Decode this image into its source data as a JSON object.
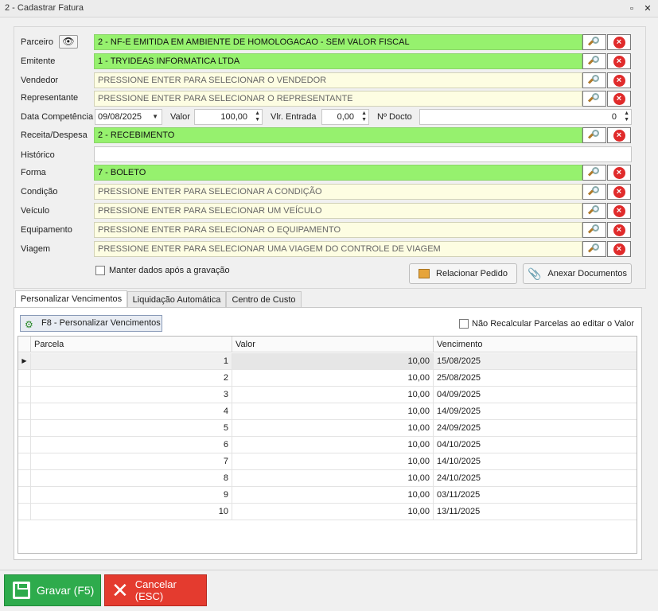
{
  "window": {
    "title": "2 - Cadastrar Fatura",
    "restore_glyph": "▫",
    "close_glyph": "✕"
  },
  "form": {
    "parceiro": {
      "label": "Parceiro",
      "value": "2 - NF-E EMITIDA EM AMBIENTE DE HOMOLOGACAO - SEM VALOR FISCAL"
    },
    "emitente": {
      "label": "Emitente",
      "value": "1 - TRYIDEAS INFORMATICA LTDA"
    },
    "vendedor": {
      "label": "Vendedor",
      "placeholder": "PRESSIONE ENTER PARA SELECIONAR O VENDEDOR"
    },
    "representante": {
      "label": "Representante",
      "placeholder": "PRESSIONE ENTER PARA SELECIONAR O REPRESENTANTE"
    },
    "data_competencia": {
      "label": "Data Competência",
      "value": "09/08/2025"
    },
    "valor": {
      "label": "Valor",
      "value": "100,00"
    },
    "vlr_entrada": {
      "label": "Vlr. Entrada",
      "value": "0,00"
    },
    "n_docto": {
      "label": "Nº Docto",
      "value": "0"
    },
    "receita_despesa": {
      "label": "Receita/Despesa",
      "value": "2 - RECEBIMENTO"
    },
    "historico": {
      "label": "Histórico",
      "value": ""
    },
    "forma": {
      "label": "Forma",
      "value": "7 - BOLETO"
    },
    "condicao": {
      "label": "Condição",
      "placeholder": "PRESSIONE ENTER PARA SELECIONAR A CONDIÇÃO"
    },
    "veiculo": {
      "label": "Veículo",
      "placeholder": "PRESSIONE ENTER PARA SELECIONAR UM VEÍCULO"
    },
    "equipamento": {
      "label": "Equipamento",
      "placeholder": "PRESSIONE ENTER PARA SELECIONAR O EQUIPAMENTO"
    },
    "viagem": {
      "label": "Viagem",
      "placeholder": "PRESSIONE ENTER PARA SELECIONAR UMA VIAGEM DO CONTROLE DE VIAGEM"
    },
    "manter_dados": {
      "label": "Manter dados após a gravação",
      "checked": false
    },
    "relacionar_pedido": "Relacionar Pedido",
    "anexar_documentos": "Anexar Documentos"
  },
  "tabs": [
    "Personalizar Vencimentos",
    "Liquidação Automática",
    "Centro de Custo"
  ],
  "active_tab": 0,
  "vencimentos": {
    "f8_button": "F8 - Personalizar Vencimentos",
    "nao_recalcular": {
      "label": "Não Recalcular Parcelas ao editar o Valor",
      "checked": false
    },
    "columns": [
      "Parcela",
      "Valor",
      "Vencimento"
    ],
    "rows": [
      {
        "parcela": "1",
        "valor": "10,00",
        "vencimento": "15/08/2025"
      },
      {
        "parcela": "2",
        "valor": "10,00",
        "vencimento": "25/08/2025"
      },
      {
        "parcela": "3",
        "valor": "10,00",
        "vencimento": "04/09/2025"
      },
      {
        "parcela": "4",
        "valor": "10,00",
        "vencimento": "14/09/2025"
      },
      {
        "parcela": "5",
        "valor": "10,00",
        "vencimento": "24/09/2025"
      },
      {
        "parcela": "6",
        "valor": "10,00",
        "vencimento": "04/10/2025"
      },
      {
        "parcela": "7",
        "valor": "10,00",
        "vencimento": "14/10/2025"
      },
      {
        "parcela": "8",
        "valor": "10,00",
        "vencimento": "24/10/2025"
      },
      {
        "parcela": "9",
        "valor": "10,00",
        "vencimento": "03/11/2025"
      },
      {
        "parcela": "10",
        "valor": "10,00",
        "vencimento": "13/11/2025"
      }
    ]
  },
  "footer": {
    "gravar": "Gravar (F5)",
    "cancelar": "Cancelar (ESC)"
  },
  "colors": {
    "filled_field": "#96f16e",
    "placeholder_field": "#fdfde2",
    "gravar": "#2eab4c",
    "cancelar": "#e43b2f"
  }
}
